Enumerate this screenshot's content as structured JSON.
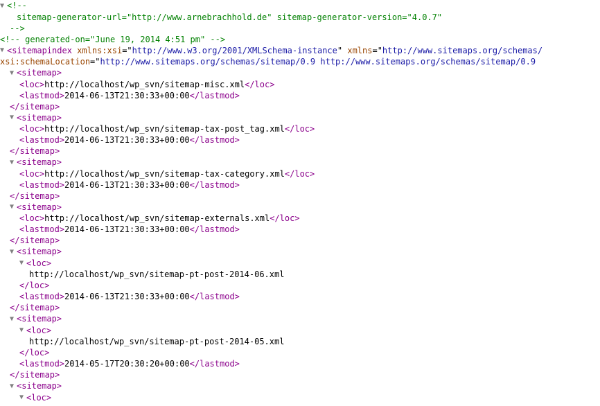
{
  "comment1": {
    "open": "<!--",
    "line1": "sitemap-generator-url=\"http://www.arnebrachhold.de\" sitemap-generator-version=\"4.0.7\"",
    "close": "-->"
  },
  "comment2": "<!--  generated-on=\"June 19, 2014 4:51 pm\"  -->",
  "root": {
    "tag_open": "<",
    "tag_name": "sitemapindex",
    "attr_xmlns_xsi_name": "xmlns:xsi",
    "attr_xmlns_xsi_val": "http://www.w3.org/2001/XMLSchema-instance",
    "attr_xmlns_name": "xmlns",
    "attr_xmlns_val": "http://www.sitemaps.org/schemas/",
    "attr_schema_name": "xsi:schemaLocation",
    "attr_schema_val": "http://www.sitemaps.org/schemas/sitemap/0.9 http://www.sitemaps.org/schemas/sitemap/0.9"
  },
  "sitemaps": [
    {
      "loc": "http://localhost/wp_svn/sitemap-misc.xml",
      "lastmod": "2014-06-13T21:30:33+00:00"
    },
    {
      "loc": "http://localhost/wp_svn/sitemap-tax-post_tag.xml",
      "lastmod": "2014-06-13T21:30:33+00:00"
    },
    {
      "loc": "http://localhost/wp_svn/sitemap-tax-category.xml",
      "lastmod": "2014-06-13T21:30:33+00:00"
    },
    {
      "loc": "http://localhost/wp_svn/sitemap-externals.xml",
      "lastmod": "2014-06-13T21:30:33+00:00"
    },
    {
      "loc": "http://localhost/wp_svn/sitemap-pt-post-2014-06.xml",
      "lastmod": "2014-06-13T21:30:33+00:00",
      "loc_expanded": true
    },
    {
      "loc": "http://localhost/wp_svn/sitemap-pt-post-2014-05.xml",
      "lastmod": "2014-05-17T20:30:20+00:00",
      "loc_expanded": true
    }
  ],
  "labels": {
    "sitemap_open": "<sitemap>",
    "sitemap_close": "</sitemap>",
    "loc_open": "<loc>",
    "loc_close": "</loc>",
    "lastmod_open": "<lastmod>",
    "lastmod_close": "</lastmod>"
  }
}
